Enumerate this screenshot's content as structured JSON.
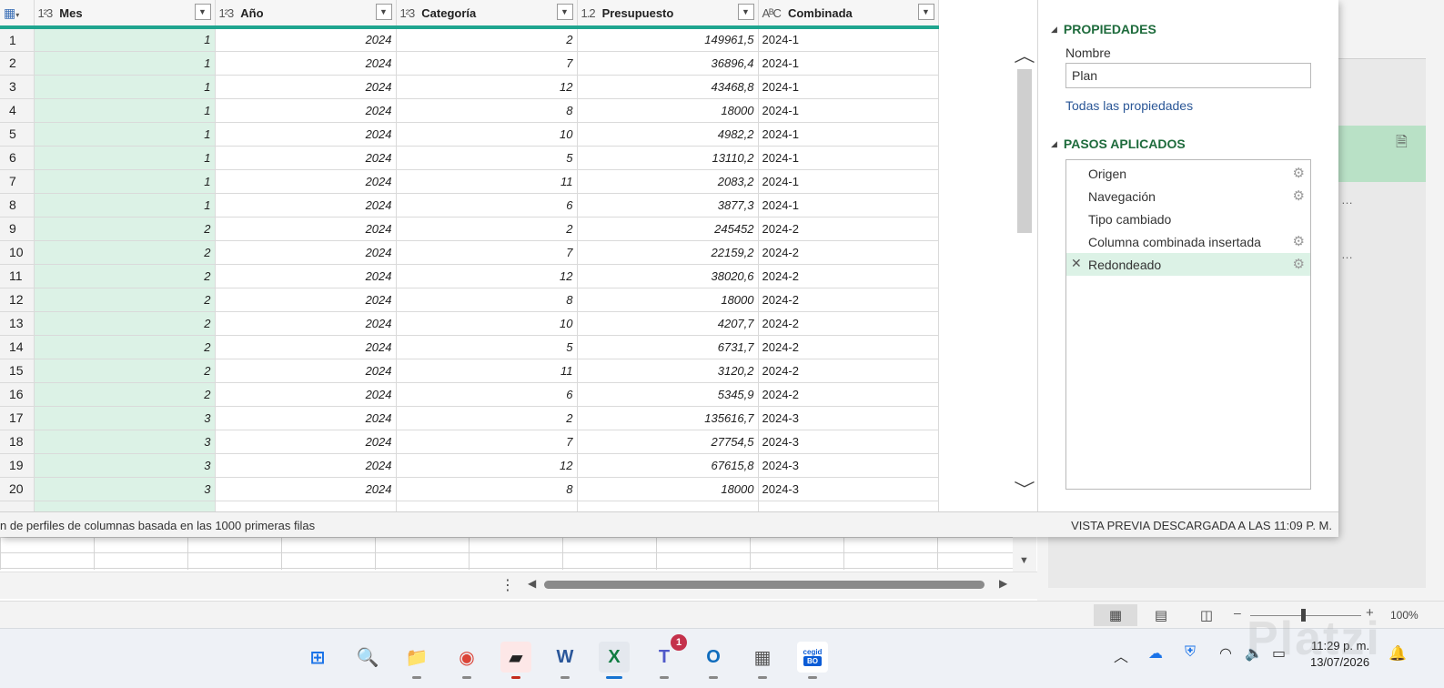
{
  "query_grid": {
    "columns": [
      {
        "name": "Mes",
        "type_icon": "1²3"
      },
      {
        "name": "Año",
        "type_icon": "1²3"
      },
      {
        "name": "Categoría",
        "type_icon": "1²3"
      },
      {
        "name": "Presupuesto",
        "type_icon": "1.2"
      },
      {
        "name": "Combinada",
        "type_icon": "AᴮC"
      }
    ],
    "rows": [
      [
        "1",
        "1",
        "2024",
        "2",
        "149961,5",
        "2024-1"
      ],
      [
        "2",
        "1",
        "2024",
        "7",
        "36896,4",
        "2024-1"
      ],
      [
        "3",
        "1",
        "2024",
        "12",
        "43468,8",
        "2024-1"
      ],
      [
        "4",
        "1",
        "2024",
        "8",
        "18000",
        "2024-1"
      ],
      [
        "5",
        "1",
        "2024",
        "10",
        "4982,2",
        "2024-1"
      ],
      [
        "6",
        "1",
        "2024",
        "5",
        "13110,2",
        "2024-1"
      ],
      [
        "7",
        "1",
        "2024",
        "11",
        "2083,2",
        "2024-1"
      ],
      [
        "8",
        "1",
        "2024",
        "6",
        "3877,3",
        "2024-1"
      ],
      [
        "9",
        "2",
        "2024",
        "2",
        "245452",
        "2024-2"
      ],
      [
        "10",
        "2",
        "2024",
        "7",
        "22159,2",
        "2024-2"
      ],
      [
        "11",
        "2",
        "2024",
        "12",
        "38020,6",
        "2024-2"
      ],
      [
        "12",
        "2",
        "2024",
        "8",
        "18000",
        "2024-2"
      ],
      [
        "13",
        "2",
        "2024",
        "10",
        "4207,7",
        "2024-2"
      ],
      [
        "14",
        "2",
        "2024",
        "5",
        "6731,7",
        "2024-2"
      ],
      [
        "15",
        "2",
        "2024",
        "11",
        "3120,2",
        "2024-2"
      ],
      [
        "16",
        "2",
        "2024",
        "6",
        "5345,9",
        "2024-2"
      ],
      [
        "17",
        "3",
        "2024",
        "2",
        "135616,7",
        "2024-3"
      ],
      [
        "18",
        "3",
        "2024",
        "7",
        "27754,5",
        "2024-3"
      ],
      [
        "19",
        "3",
        "2024",
        "12",
        "67615,8",
        "2024-3"
      ],
      [
        "20",
        "3",
        "2024",
        "8",
        "18000",
        "2024-3"
      ]
    ],
    "selected_column": "Mes"
  },
  "status_bar": {
    "left": "n de perfiles de columnas basada en las 1000 primeras filas",
    "right": "VISTA PREVIA DESCARGADA A LAS 11:09 P. M."
  },
  "settings": {
    "properties_title": "PROPIEDADES",
    "name_label": "Nombre",
    "name_value": "Plan",
    "all_properties_link": "Todas las propiedades",
    "steps_title": "PASOS APLICADOS",
    "steps": [
      {
        "label": "Origen",
        "gear": true,
        "active": false
      },
      {
        "label": "Navegación",
        "gear": true,
        "active": false
      },
      {
        "label": "Tipo cambiado",
        "gear": false,
        "active": false
      },
      {
        "label": "Columna combinada insertada",
        "gear": true,
        "active": false
      },
      {
        "label": "Redondeado",
        "gear": true,
        "active": true
      }
    ]
  },
  "excel_status": {
    "zoom_level": "100%"
  },
  "taskbar": {
    "apps": [
      {
        "name": "windows-start",
        "label": "⊞",
        "color": "#1a73e8"
      },
      {
        "name": "search",
        "label": "🔍",
        "color": "#222"
      },
      {
        "name": "file-explorer",
        "label": "📁",
        "color": "#e8b300"
      },
      {
        "name": "chrome",
        "label": "◉",
        "color": "#db4437"
      },
      {
        "name": "sticky-notes",
        "label": "▰",
        "color": "#222"
      },
      {
        "name": "word",
        "label": "W",
        "color": "#2b579a"
      },
      {
        "name": "excel",
        "label": "X",
        "color": "#107c41"
      },
      {
        "name": "teams",
        "label": "T",
        "color": "#5059c9",
        "badge": "1"
      },
      {
        "name": "outlook",
        "label": "O",
        "color": "#0f6cbd"
      },
      {
        "name": "calculator",
        "label": "▦",
        "color": "#555"
      },
      {
        "name": "cegid",
        "label": "cegid",
        "sub": "BO",
        "color": "#0a5bd6"
      }
    ],
    "time": "11:29 p. m.",
    "date": "13/07/2026"
  },
  "watermark": "Platzi",
  "colors": {
    "accent_green": "#1e6b3c",
    "header_underline": "#1fa58f",
    "selected_fill": "#dcf2e6",
    "link_blue": "#2b5797"
  }
}
